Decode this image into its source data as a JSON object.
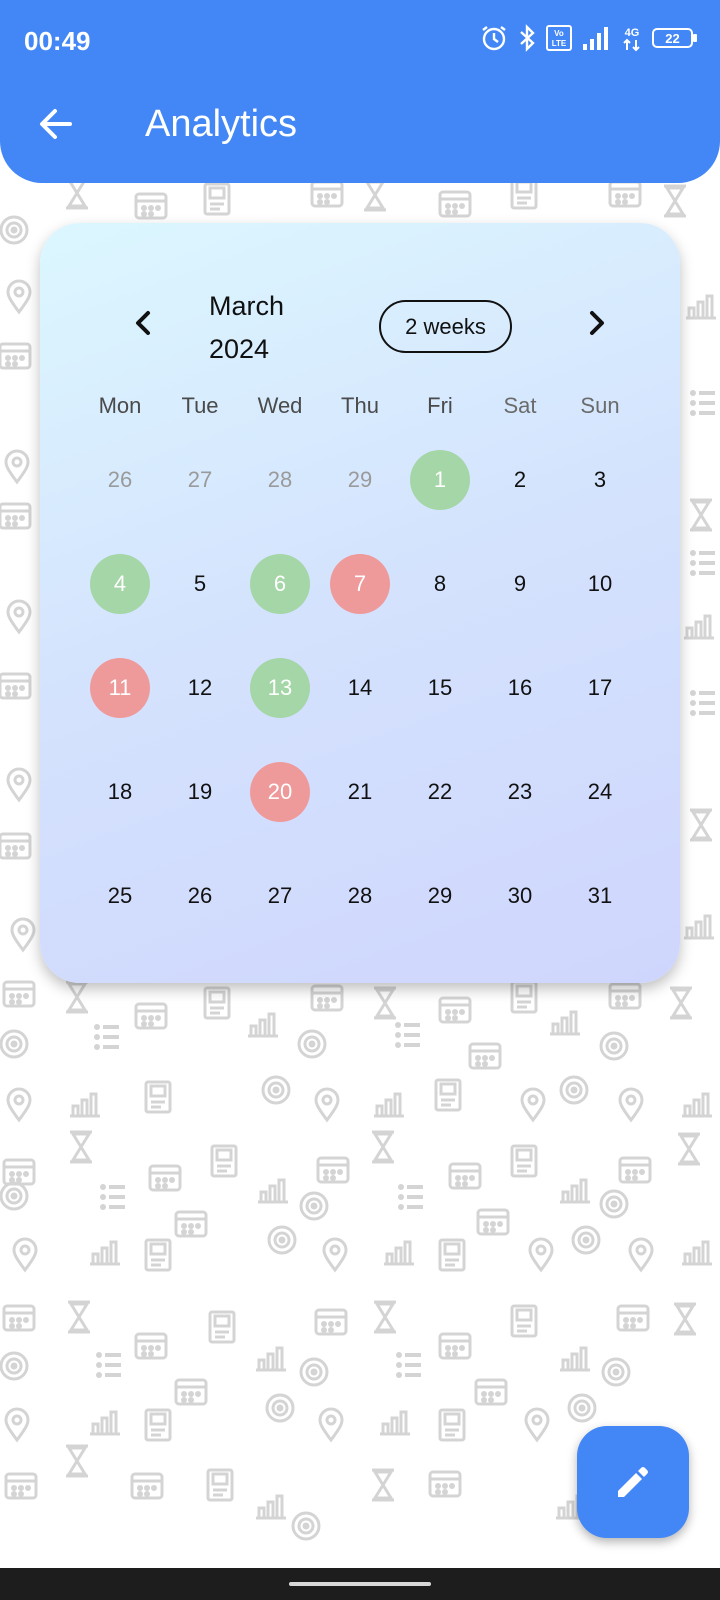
{
  "status_bar": {
    "time": "00:49",
    "battery_level": "22",
    "icons": [
      "alarm-icon",
      "bluetooth-icon",
      "volte-icon",
      "signal-icon",
      "4g-icon",
      "battery-icon"
    ]
  },
  "app_bar": {
    "title": "Analytics",
    "back_icon": "arrow-back-icon",
    "color": "#4287f5"
  },
  "calendar": {
    "month": "March",
    "year": "2024",
    "format_button": "2 weeks",
    "weekdays": [
      "Mon",
      "Tue",
      "Wed",
      "Thu",
      "Fri",
      "Sat",
      "Sun"
    ],
    "days": [
      {
        "label": "26",
        "state": "outside"
      },
      {
        "label": "27",
        "state": "outside"
      },
      {
        "label": "28",
        "state": "outside"
      },
      {
        "label": "29",
        "state": "outside"
      },
      {
        "label": "1",
        "state": "green"
      },
      {
        "label": "2",
        "state": "normal"
      },
      {
        "label": "3",
        "state": "normal"
      },
      {
        "label": "4",
        "state": "green"
      },
      {
        "label": "5",
        "state": "normal"
      },
      {
        "label": "6",
        "state": "green"
      },
      {
        "label": "7",
        "state": "red"
      },
      {
        "label": "8",
        "state": "normal"
      },
      {
        "label": "9",
        "state": "normal"
      },
      {
        "label": "10",
        "state": "normal"
      },
      {
        "label": "11",
        "state": "red"
      },
      {
        "label": "12",
        "state": "normal"
      },
      {
        "label": "13",
        "state": "green"
      },
      {
        "label": "14",
        "state": "normal"
      },
      {
        "label": "15",
        "state": "normal"
      },
      {
        "label": "16",
        "state": "normal"
      },
      {
        "label": "17",
        "state": "normal"
      },
      {
        "label": "18",
        "state": "normal"
      },
      {
        "label": "19",
        "state": "normal"
      },
      {
        "label": "20",
        "state": "red"
      },
      {
        "label": "21",
        "state": "normal"
      },
      {
        "label": "22",
        "state": "normal"
      },
      {
        "label": "23",
        "state": "normal"
      },
      {
        "label": "24",
        "state": "normal"
      },
      {
        "label": "25",
        "state": "normal"
      },
      {
        "label": "26",
        "state": "normal"
      },
      {
        "label": "27",
        "state": "normal"
      },
      {
        "label": "28",
        "state": "normal"
      },
      {
        "label": "29",
        "state": "normal"
      },
      {
        "label": "30",
        "state": "normal"
      },
      {
        "label": "31",
        "state": "normal"
      }
    ],
    "marker_colors": {
      "green": "#a5d6a7",
      "red": "#ef9a9a"
    }
  },
  "fab": {
    "icon": "edit-pencil-icon",
    "color": "#4287f5"
  }
}
